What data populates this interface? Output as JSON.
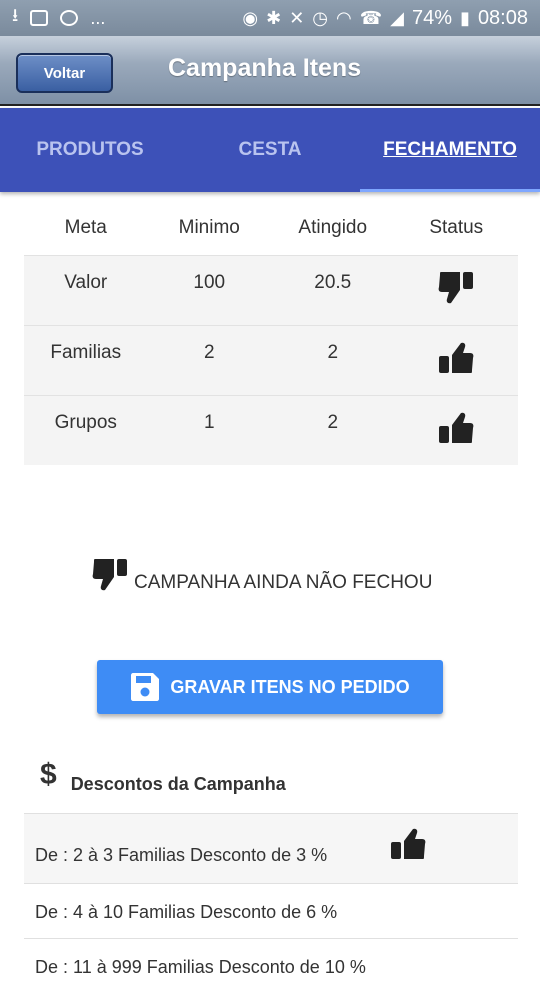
{
  "statusbar": {
    "more": "...",
    "battery": "74%",
    "time": "08:08"
  },
  "appbar": {
    "back_label": "Voltar",
    "title": "Campanha Itens"
  },
  "tabs": [
    {
      "label": "PRODUTOS",
      "active": false
    },
    {
      "label": "CESTA",
      "active": false
    },
    {
      "label": "FECHAMENTO",
      "active": true
    }
  ],
  "table": {
    "headers": [
      "Meta",
      "Minimo",
      "Atingido",
      "Status"
    ],
    "rows": [
      {
        "meta": "Valor",
        "minimo": "100",
        "atingido": "20.5",
        "status": "thumbs-down-icon"
      },
      {
        "meta": "Familias",
        "minimo": "2",
        "atingido": "2",
        "status": "thumbs-up-icon"
      },
      {
        "meta": "Grupos",
        "minimo": "1",
        "atingido": "2",
        "status": "thumbs-up-icon"
      }
    ]
  },
  "message": {
    "text": "CAMPANHA AINDA NÃO FECHOU",
    "icon": "thumbs-down-icon"
  },
  "save_button": {
    "label": "GRAVAR ITENS NO PEDIDO",
    "icon": "save-icon"
  },
  "discounts": {
    "symbol": "$",
    "title": "Descontos da Campanha",
    "items": [
      {
        "text": "De : 2 à 3 Familias Desconto de 3 %",
        "icon": "thumbs-up-icon"
      },
      {
        "text": "De : 4 à 10 Familias Desconto de 6 %"
      },
      {
        "text": "De : 11 à 999 Familias Desconto de 10 %"
      }
    ]
  },
  "colors": {
    "tab_bar": "#3d51b8",
    "button": "#3e8cf5",
    "text": "#333333"
  }
}
